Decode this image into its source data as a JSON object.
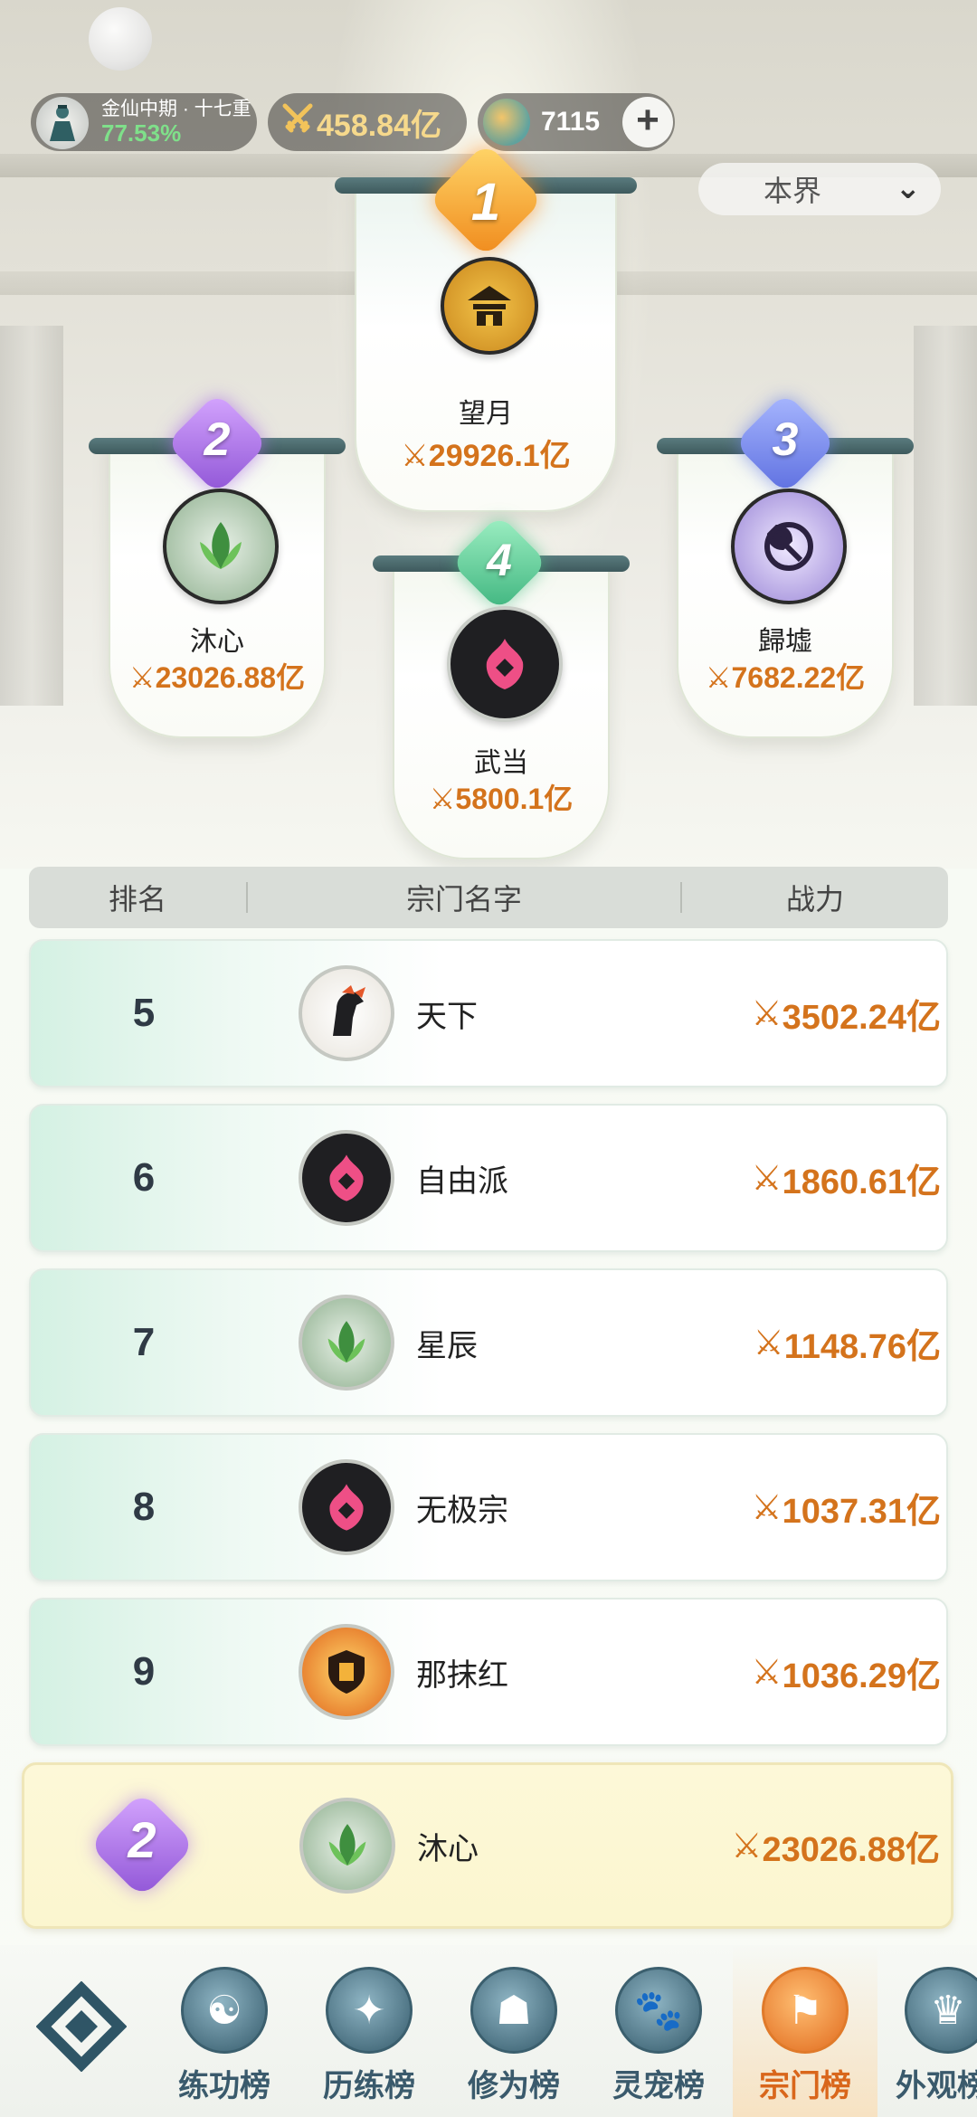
{
  "header": {
    "realm_rank": "金仙中期 · 十七重",
    "realm_progress": "77.53%",
    "combat_power": "458.84亿",
    "gem_count": "7115",
    "add_label": "+",
    "server_select": "本界"
  },
  "podium": [
    {
      "rank": "1",
      "name": "望月",
      "power": "29926.1亿",
      "emblem": "pavilion-emblem-icon"
    },
    {
      "rank": "2",
      "name": "沐心",
      "power": "23026.88亿",
      "emblem": "lotus-emblem-icon"
    },
    {
      "rank": "3",
      "name": "歸墟",
      "power": "7682.22亿",
      "emblem": "axe-emblem-icon"
    },
    {
      "rank": "4",
      "name": "武当",
      "power": "5800.1亿",
      "emblem": "flame-emblem-icon"
    }
  ],
  "table": {
    "headers": [
      "排名",
      "宗门名字",
      "战力"
    ],
    "rows": [
      {
        "rank": "5",
        "name": "天下",
        "power": "3502.24亿",
        "emblem": "horse-emblem-icon"
      },
      {
        "rank": "6",
        "name": "自由派",
        "power": "1860.61亿",
        "emblem": "flame-emblem-icon"
      },
      {
        "rank": "7",
        "name": "星辰",
        "power": "1148.76亿",
        "emblem": "lotus-emblem-icon"
      },
      {
        "rank": "8",
        "name": "无极宗",
        "power": "1037.31亿",
        "emblem": "flame-emblem-icon"
      },
      {
        "rank": "9",
        "name": "那抹红",
        "power": "1036.29亿",
        "emblem": "shield-emblem-icon"
      }
    ]
  },
  "my_sect": {
    "rank": "2",
    "name": "沐心",
    "power": "23026.88亿",
    "emblem": "lotus-emblem-icon"
  },
  "nav": {
    "items": [
      {
        "label": "",
        "icon": "menu-diamond-icon"
      },
      {
        "label": "练功榜",
        "icon": "yin-yang-icon"
      },
      {
        "label": "历练榜",
        "icon": "star-burst-icon"
      },
      {
        "label": "修为榜",
        "icon": "sage-icon"
      },
      {
        "label": "灵宠榜",
        "icon": "pet-cat-icon"
      },
      {
        "label": "宗门榜",
        "icon": "sect-banner-icon"
      },
      {
        "label": "外观榜",
        "icon": "appearance-icon"
      }
    ],
    "active_index": 5
  },
  "colors": {
    "power_orange": "#d4731c",
    "gold": "#f2b01c",
    "purple": "#a86ee0",
    "blue": "#6f86e8",
    "green": "#47c08f",
    "nav_active": "#e0691c"
  }
}
